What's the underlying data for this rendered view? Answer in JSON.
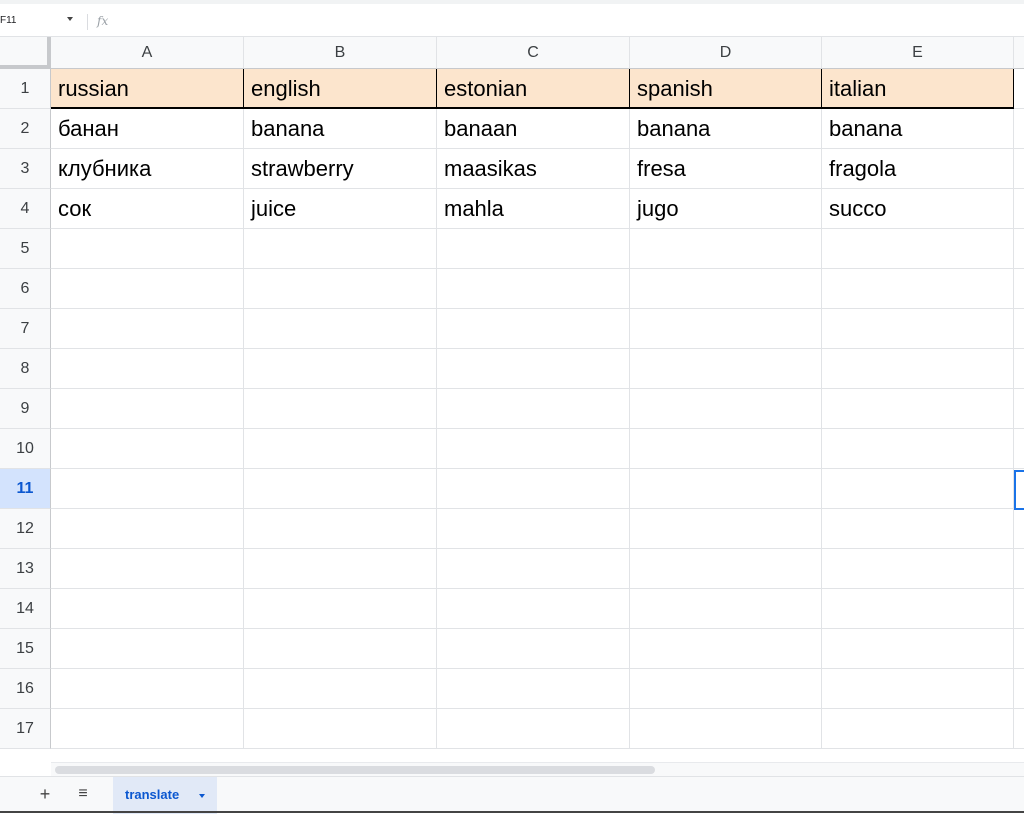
{
  "formula_bar": {
    "name_box": "F11",
    "fx_label": "fx",
    "formula": ""
  },
  "columns": [
    "A",
    "B",
    "C",
    "D",
    "E"
  ],
  "rows": [
    "1",
    "2",
    "3",
    "4",
    "5",
    "6",
    "7",
    "8",
    "9",
    "10",
    "11",
    "12",
    "13",
    "14",
    "15",
    "16",
    "17"
  ],
  "selected_row": "11",
  "cells": [
    [
      "russian",
      "english",
      "estonian",
      "spanish",
      "italian"
    ],
    [
      "банан",
      "banana",
      "banaan",
      "banana",
      "banana"
    ],
    [
      "клубника",
      "strawberry",
      "maasikas",
      "fresa",
      "fragola"
    ],
    [
      "сок",
      "juice",
      "mahla",
      "jugo",
      "succo"
    ]
  ],
  "colors": {
    "header_fill": "#fce5cd",
    "selection": "#1a73e8",
    "tab_text": "#0b57d0"
  },
  "sheet_bar": {
    "add_icon": "+",
    "list_icon": "≡",
    "tabs": [
      {
        "label": "translate",
        "active": true
      }
    ]
  }
}
